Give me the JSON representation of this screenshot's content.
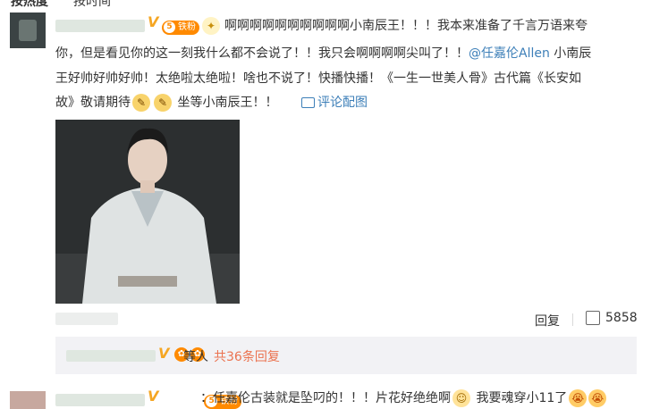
{
  "header": {
    "left": "按热度",
    "right": "按时间"
  },
  "comment": {
    "vip_mark": "V",
    "badge_level": "5",
    "badge_label": "铁粉",
    "line1": "啊啊啊啊啊啊啊啊啊啊小南辰王！！！我本来准备了千言万语来夸",
    "line2_a": "你，但是看见你的这一刻我什么都不会说了！！我只会啊啊啊啊尖叫了！！",
    "line2_mention": "@任嘉伦Allen",
    "line2_b": " 小南辰",
    "line3_a": "王好帅好帅好帅！太绝啦太绝啦！啥也不说了！快播快播！",
    "line3_b": "《一生一世美人骨》古代篇《长安如",
    "line4_a": "故》敬请期待",
    "line4_b": " 坐等小南辰王！！",
    "pic_comment_link": "评论配图",
    "reply_label": "回复",
    "like_count": "5858"
  },
  "reply_strip": {
    "vip_mark": "V",
    "suffix": "等人",
    "total_link": "共36条回复"
  },
  "next_comment": {
    "vip_mark": "V",
    "badge_level": "5",
    "badge_label": "铁粉",
    "text_a": "：任嘉伦古装就是坠叼的！！！片花好绝绝啊",
    "text_b": " 我要魂穿小11了"
  },
  "colors": {
    "accent": "#eb7350",
    "link_blue": "#3d7fb8",
    "badge": "#ff8a00",
    "vip": "#f5a623"
  },
  "icons": [
    "sparkle-emoji",
    "clapper-emoji",
    "image-icon",
    "thumbs-up-icon",
    "crying-emoji"
  ]
}
